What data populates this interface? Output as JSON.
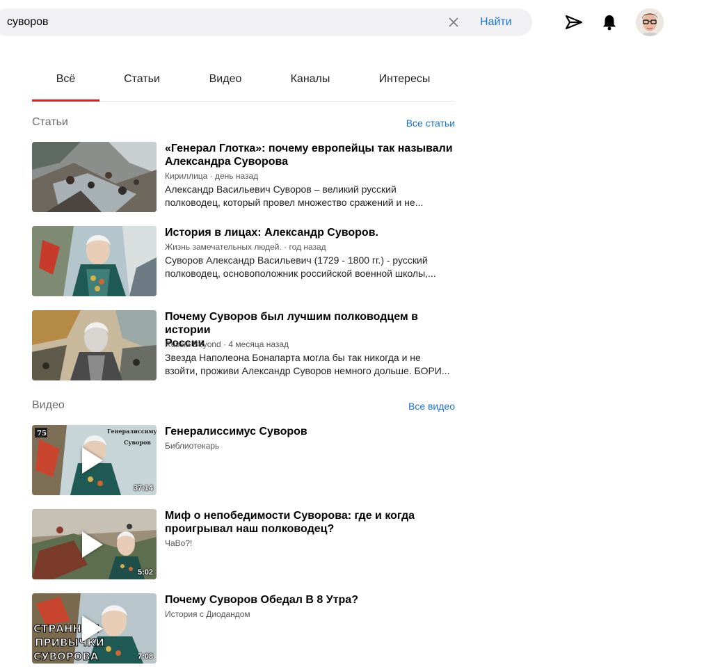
{
  "search": {
    "value": "суворов",
    "find_label": "Найти"
  },
  "tabs": [
    {
      "label": "Всё",
      "active": true
    },
    {
      "label": "Статьи"
    },
    {
      "label": "Видео"
    },
    {
      "label": "Каналы"
    },
    {
      "label": "Интересы"
    }
  ],
  "articles_section": {
    "title": "Статьи",
    "all_link": "Все статьи",
    "items": [
      {
        "title_line1": "«Генерал Глотка»: почему европейцы так называли",
        "title_line2": "Александра Суворова",
        "source": "Кириллица",
        "time": "день назад",
        "snippet_line1": "Александр Васильевич Суворов – великий русский",
        "snippet_line2": "полководец, который провел множество сражений и не..."
      },
      {
        "title_line1": "История в лицах: Александр Суворов.",
        "title_line2": "",
        "source": "Жизнь замечательных людей.",
        "time": "год назад",
        "snippet_line1": "Суворов Александр Васильевич (1729 - 1800 гг.) - русский",
        "snippet_line2": "полководец, основоположник российской военной школы,..."
      },
      {
        "title_line1": "Почему Суворов был лучшим полководцем в истории",
        "title_line2": "России",
        "source": "Russia Beyond",
        "time": "4 месяца назад",
        "snippet_line1": "Звезда Наполеона Бонапарта могла бы так никогда и не",
        "snippet_line2": "взойти, проживи Александр Суворов немного дольше. БОРИ..."
      }
    ]
  },
  "videos_section": {
    "title": "Видео",
    "all_link": "Все видео",
    "items": [
      {
        "title_line1": "Генералиссимус Суворов",
        "title_line2": "",
        "channel": "Библиотекарь",
        "duration": "37:14",
        "thumb_text_1": "Генералиссимус",
        "thumb_text_2": "Суворов",
        "thumb_badge": "75"
      },
      {
        "title_line1": "Миф о непобедимости Суворова: где и когда",
        "title_line2": "проигрывал наш полководец?",
        "channel": "ЧаВо?!",
        "duration": "5:02"
      },
      {
        "title_line1": "Почему Суворов Обедал В 8 Утра?",
        "title_line2": "",
        "channel": "История с Диодандом",
        "duration": "7:08",
        "thumb_text_1": "СТРАННЫЕ",
        "thumb_text_2": "ПРИВЫЧКИ",
        "thumb_text_3": "СУВОРОВА"
      }
    ]
  },
  "colors": {
    "accent": "#1a73d9",
    "active_tab": "#e01e1e",
    "search_bg": "#f1f1f3"
  },
  "icons": [
    "close-icon",
    "send-icon",
    "bell-icon",
    "play-icon"
  ]
}
